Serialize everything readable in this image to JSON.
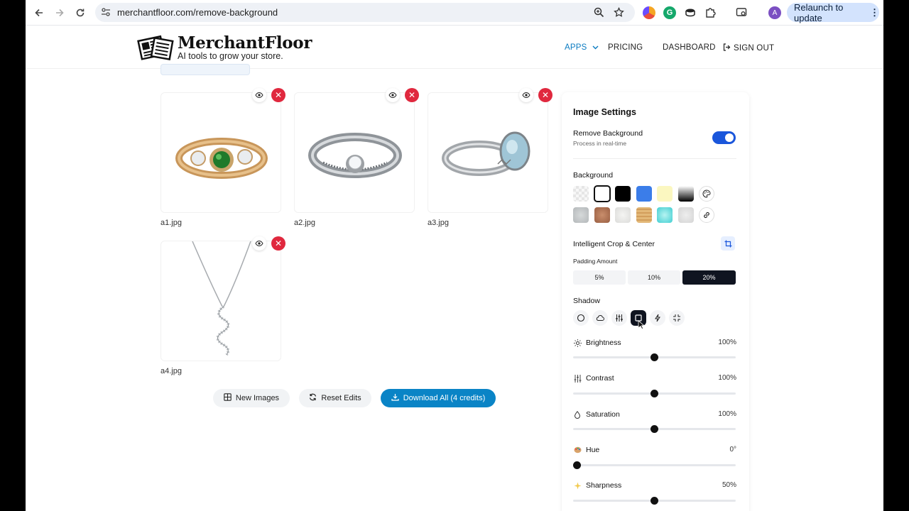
{
  "browser": {
    "url": "merchantfloor.com/remove-background",
    "relaunch_label": "Relaunch to update",
    "profile_initial": "A"
  },
  "header": {
    "brand": "MerchantFloor",
    "tagline": "AI tools to grow your store.",
    "nav": {
      "apps": "APPS",
      "pricing": "PRICING",
      "dashboard": "DASHBOARD",
      "sign_out": "SIGN OUT"
    },
    "accent_color": "#0a7bc1"
  },
  "gallery": {
    "images": [
      {
        "filename": "a1.jpg"
      },
      {
        "filename": "a2.jpg"
      },
      {
        "filename": "a3.jpg"
      },
      {
        "filename": "a4.jpg"
      }
    ]
  },
  "actions": {
    "new_images": "New Images",
    "reset_edits": "Reset Edits",
    "download_all": "Download All (4 credits)"
  },
  "settings": {
    "title": "Image Settings",
    "remove_background": {
      "label": "Remove Background",
      "sub": "Process in real-time",
      "enabled": true
    },
    "background": {
      "label": "Background",
      "swatches": [
        "transparent",
        "#ffffff",
        "#000000",
        "#3b7de9",
        "#fbf7c0",
        "gradient",
        "palette-icon",
        "#c7cacb",
        "#b87c5a",
        "#e8e8e6",
        "#ddb070",
        "#77e0e0",
        "#e3e3e3",
        "link-icon"
      ],
      "selected": "#ffffff"
    },
    "crop": {
      "label": "Intelligent Crop & Center",
      "padding_label": "Padding Amount",
      "options": [
        "5%",
        "10%",
        "20%"
      ],
      "selected": "20%"
    },
    "shadow": {
      "label": "Shadow",
      "icons": [
        "circle-icon",
        "cloud-icon",
        "sliders-icon",
        "square-icon",
        "bolt-icon",
        "shrink-icon"
      ],
      "selected": "square-icon"
    },
    "adjustments": [
      {
        "label": "Brightness",
        "value": "100%",
        "fraction": 0.5
      },
      {
        "label": "Contrast",
        "value": "100%",
        "fraction": 0.5
      },
      {
        "label": "Saturation",
        "value": "100%",
        "fraction": 0.5
      },
      {
        "label": "Hue",
        "value": "0°",
        "fraction": 0.0
      },
      {
        "label": "Sharpness",
        "value": "50%",
        "fraction": 0.5
      }
    ]
  }
}
